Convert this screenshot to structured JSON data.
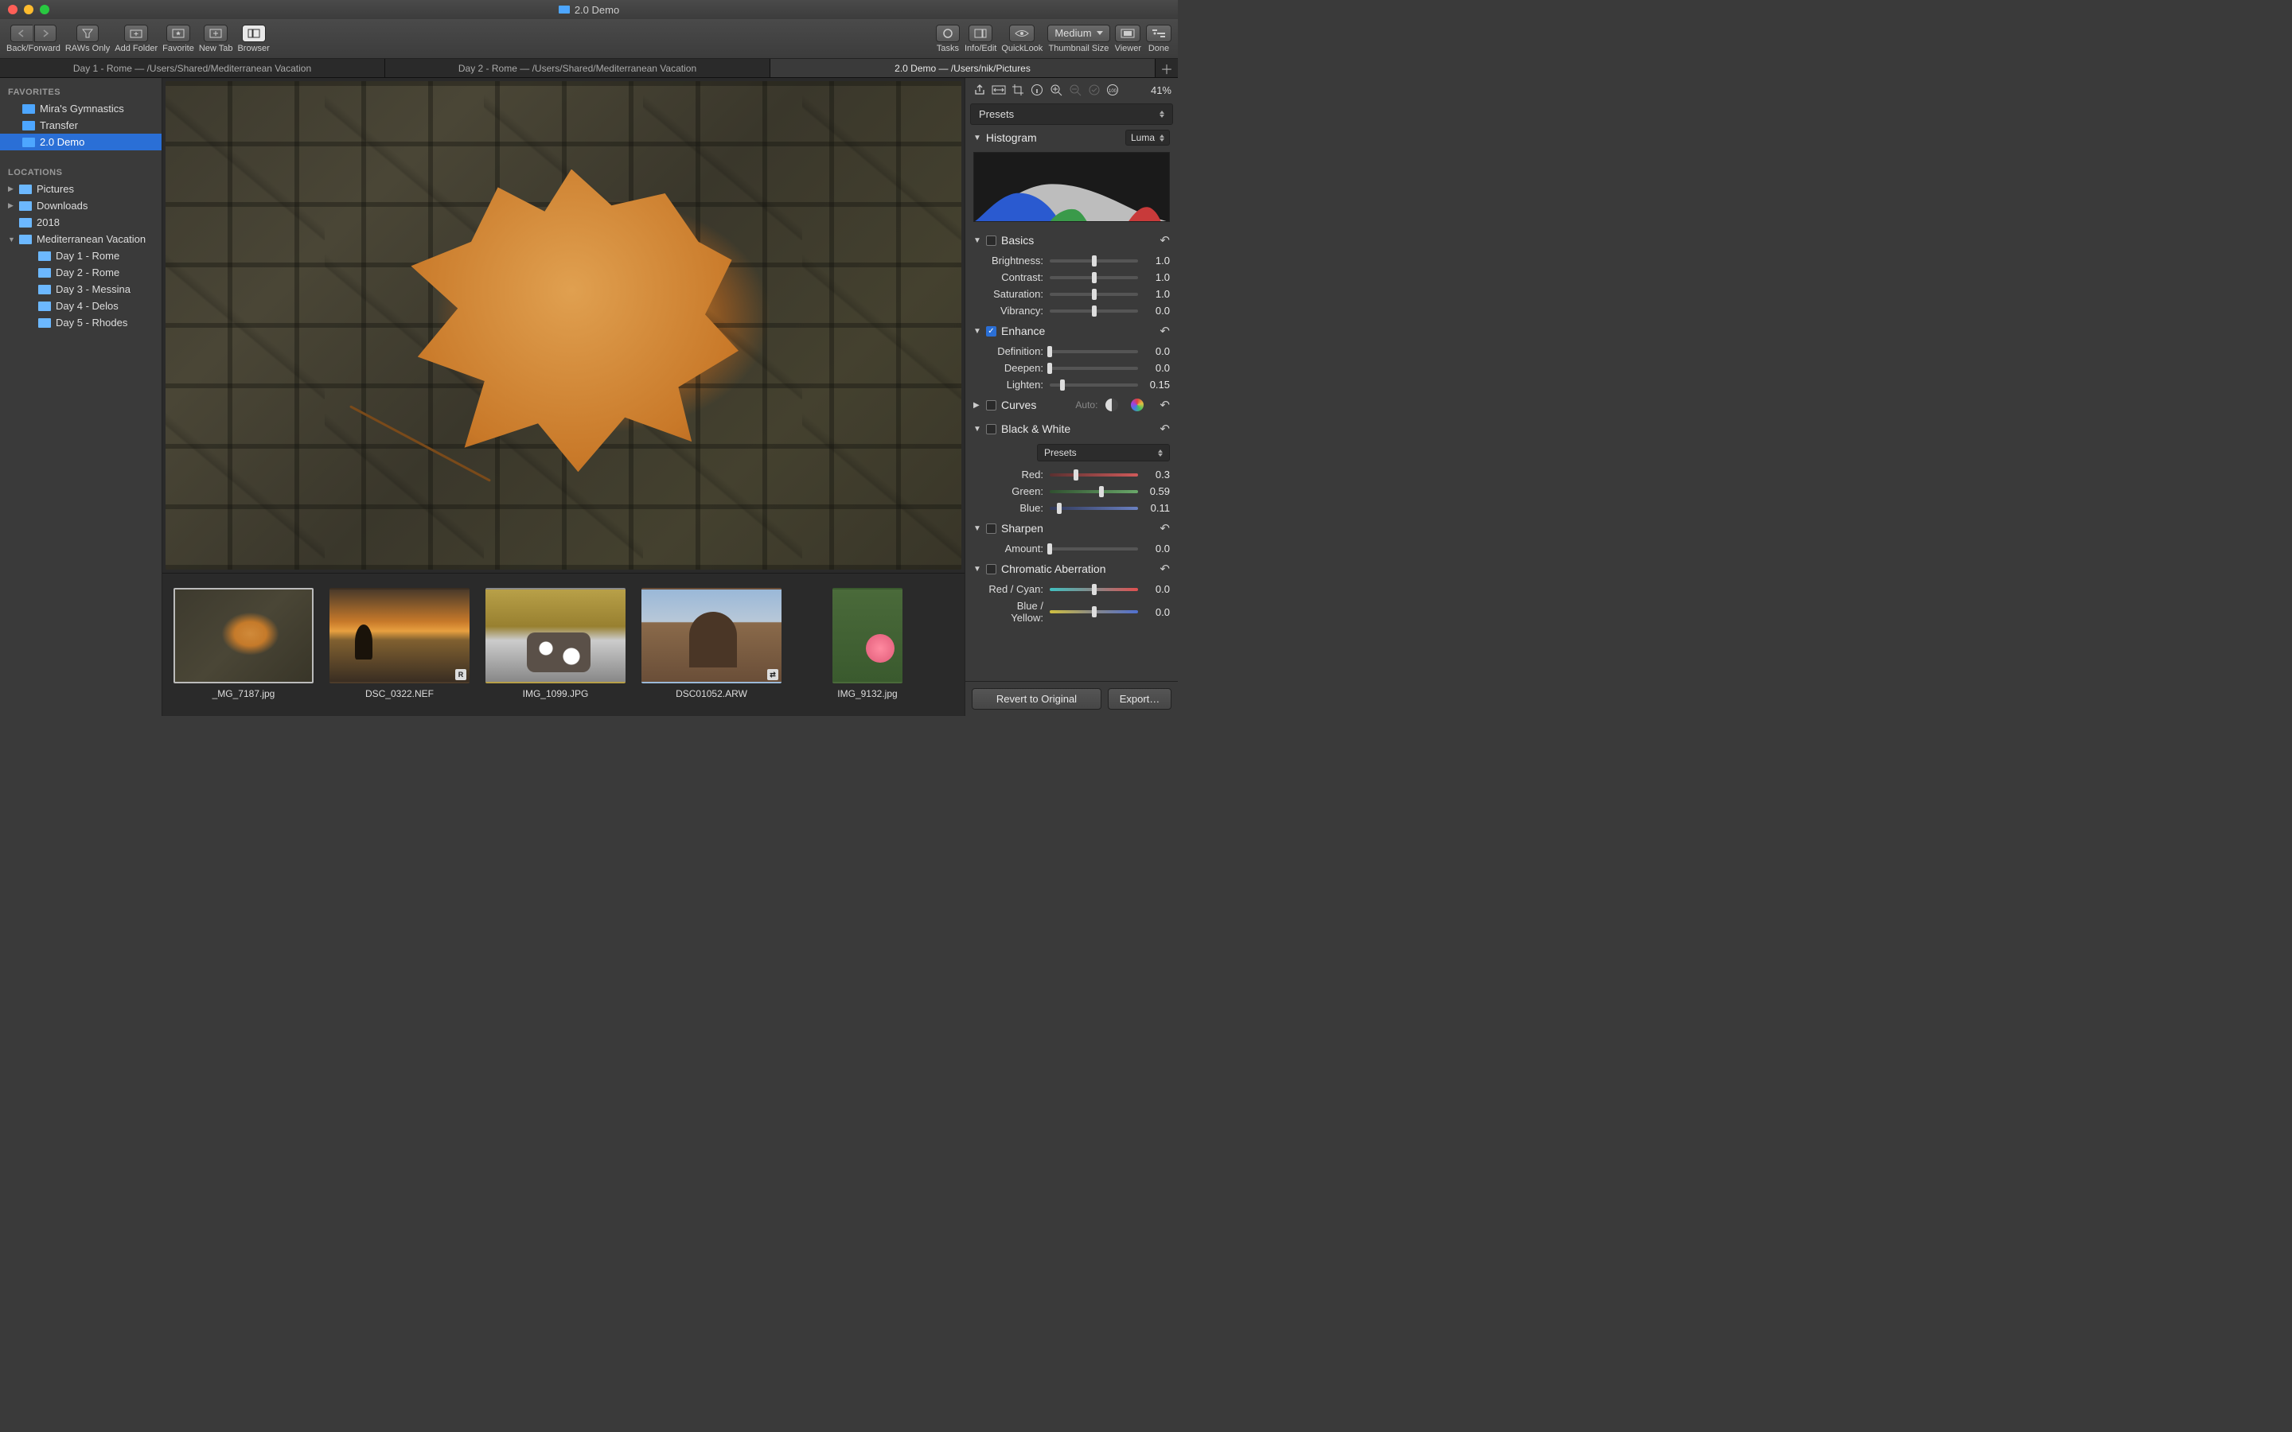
{
  "window": {
    "title": "2.0 Demo"
  },
  "toolbar": {
    "backforward": "Back/Forward",
    "rawsonly": "RAWs Only",
    "addfolder": "Add Folder",
    "favorite": "Favorite",
    "newtab": "New Tab",
    "browser": "Browser",
    "tasks": "Tasks",
    "infoedit": "Info/Edit",
    "quicklook": "QuickLook",
    "thumbnail_size_label": "Thumbnail Size",
    "thumbnail_size_value": "Medium",
    "viewer": "Viewer",
    "done": "Done"
  },
  "tabs": [
    {
      "label": "Day 1 - Rome  —  /Users/Shared/Mediterranean Vacation",
      "active": false
    },
    {
      "label": "Day 2 - Rome  —  /Users/Shared/Mediterranean Vacation",
      "active": false
    },
    {
      "label": "2.0 Demo  —  /Users/nik/Pictures",
      "active": true
    }
  ],
  "sidebar": {
    "favorites_label": "FAVORITES",
    "locations_label": "LOCATIONS",
    "favorites": [
      {
        "name": "Mira's Gymnastics"
      },
      {
        "name": "Transfer"
      },
      {
        "name": "2.0 Demo",
        "selected": true
      }
    ],
    "locations": [
      {
        "name": "Pictures",
        "disclosure": "▶"
      },
      {
        "name": "Downloads",
        "disclosure": "▶"
      },
      {
        "name": "2018"
      },
      {
        "name": "Mediterranean Vacation",
        "disclosure": "▼",
        "children": [
          {
            "name": "Day 1 - Rome"
          },
          {
            "name": "Day 2 - Rome"
          },
          {
            "name": "Day 3 - Messina"
          },
          {
            "name": "Day 4 - Delos"
          },
          {
            "name": "Day 5 - Rhodes"
          }
        ]
      }
    ]
  },
  "filmstrip": [
    {
      "name": "_MG_7187.jpg",
      "selected": true,
      "badge": ""
    },
    {
      "name": "DSC_0322.NEF",
      "badge": "R"
    },
    {
      "name": "IMG_1099.JPG",
      "badge": ""
    },
    {
      "name": "DSC01052.ARW",
      "badge": "⇄"
    },
    {
      "name": "IMG_9132.jpg",
      "badge": "",
      "cut": true
    }
  ],
  "panel": {
    "zoom": "41%",
    "presets_label": "Presets",
    "histogram": {
      "title": "Histogram",
      "mode": "Luma"
    },
    "sections": {
      "basics": {
        "title": "Basics",
        "params": [
          {
            "label": "Brightness:",
            "value": "1.0",
            "pos": 50
          },
          {
            "label": "Contrast:",
            "value": "1.0",
            "pos": 50
          },
          {
            "label": "Saturation:",
            "value": "1.0",
            "pos": 50
          },
          {
            "label": "Vibrancy:",
            "value": "0.0",
            "pos": 50
          }
        ]
      },
      "enhance": {
        "title": "Enhance",
        "checked": true,
        "params": [
          {
            "label": "Definition:",
            "value": "0.0",
            "pos": 0
          },
          {
            "label": "Deepen:",
            "value": "0.0",
            "pos": 0
          },
          {
            "label": "Lighten:",
            "value": "0.15",
            "pos": 14
          }
        ]
      },
      "curves": {
        "title": "Curves",
        "auto_label": "Auto:"
      },
      "bw": {
        "title": "Black & White",
        "presets_label": "Presets",
        "params": [
          {
            "label": "Red:",
            "value": "0.3",
            "pos": 30,
            "grad": "r"
          },
          {
            "label": "Green:",
            "value": "0.59",
            "pos": 59,
            "grad": "g"
          },
          {
            "label": "Blue:",
            "value": "0.11",
            "pos": 11,
            "grad": "b"
          }
        ]
      },
      "sharpen": {
        "title": "Sharpen",
        "params": [
          {
            "label": "Amount:",
            "value": "0.0",
            "pos": 0
          }
        ]
      },
      "chroma": {
        "title": "Chromatic Aberration",
        "params": [
          {
            "label": "Red / Cyan:",
            "value": "0.0",
            "pos": 50,
            "grad": "rc"
          },
          {
            "label": "Blue / Yellow:",
            "value": "0.0",
            "pos": 50,
            "grad": "by"
          }
        ]
      }
    },
    "footer": {
      "revert": "Revert to Original",
      "export": "Export…"
    }
  }
}
